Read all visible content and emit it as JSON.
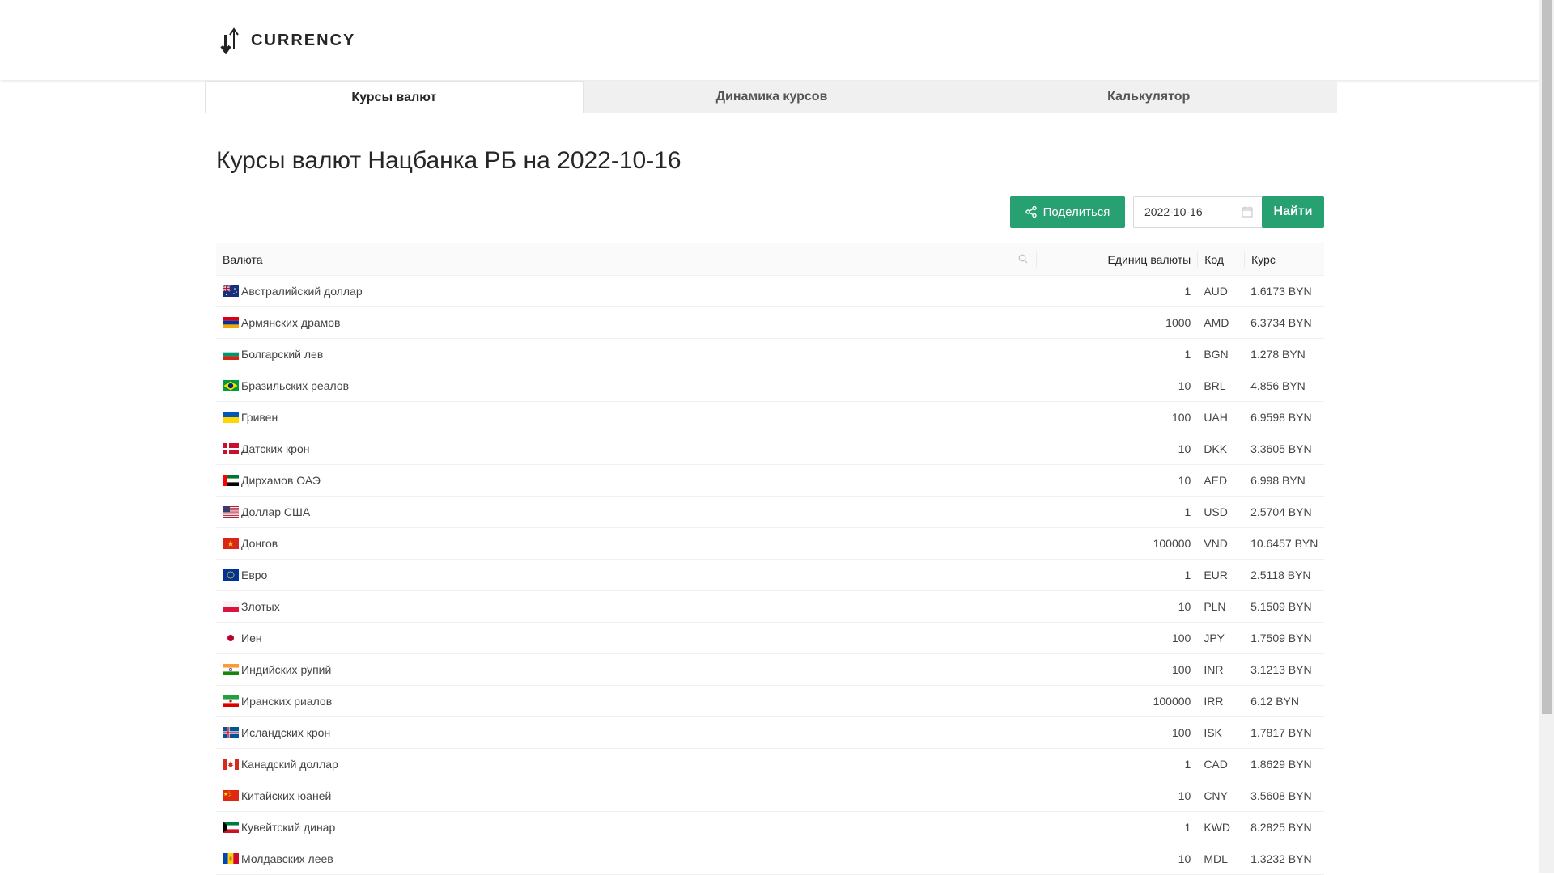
{
  "app": {
    "logo_text": "CURRENCY"
  },
  "tabs": [
    {
      "label": "Курсы валют",
      "active": true
    },
    {
      "label": "Динамика курсов",
      "active": false
    },
    {
      "label": "Калькулятор",
      "active": false
    }
  ],
  "page": {
    "title": "Курсы валют Нацбанка РБ на 2022-10-16"
  },
  "toolbar": {
    "share_label": "Поделиться",
    "date_value": "2022-10-16",
    "find_label": "Найти"
  },
  "colors": {
    "accent": "#27a172"
  },
  "table": {
    "columns": {
      "name": "Валюта",
      "units": "Единиц валюты",
      "code": "Код",
      "rate": "Курс"
    },
    "rows": [
      {
        "name": "Австралийский доллар",
        "units": "1",
        "code": "AUD",
        "rate": "1.6173 BYN",
        "flag": "au"
      },
      {
        "name": "Армянских драмов",
        "units": "1000",
        "code": "AMD",
        "rate": "6.3734 BYN",
        "flag": "am"
      },
      {
        "name": "Болгарский лев",
        "units": "1",
        "code": "BGN",
        "rate": "1.278 BYN",
        "flag": "bg"
      },
      {
        "name": "Бразильских реалов",
        "units": "10",
        "code": "BRL",
        "rate": "4.856 BYN",
        "flag": "br"
      },
      {
        "name": "Гривен",
        "units": "100",
        "code": "UAH",
        "rate": "6.9598 BYN",
        "flag": "ua"
      },
      {
        "name": "Датских крон",
        "units": "10",
        "code": "DKK",
        "rate": "3.3605 BYN",
        "flag": "dk"
      },
      {
        "name": "Дирхамов ОАЭ",
        "units": "10",
        "code": "AED",
        "rate": "6.998 BYN",
        "flag": "ae"
      },
      {
        "name": "Доллар США",
        "units": "1",
        "code": "USD",
        "rate": "2.5704 BYN",
        "flag": "us"
      },
      {
        "name": "Донгов",
        "units": "100000",
        "code": "VND",
        "rate": "10.6457 BYN",
        "flag": "vn"
      },
      {
        "name": "Евро",
        "units": "1",
        "code": "EUR",
        "rate": "2.5118 BYN",
        "flag": "eu"
      },
      {
        "name": "Злотых",
        "units": "10",
        "code": "PLN",
        "rate": "5.1509 BYN",
        "flag": "pl"
      },
      {
        "name": "Иен",
        "units": "100",
        "code": "JPY",
        "rate": "1.7509 BYN",
        "flag": "jp"
      },
      {
        "name": "Индийских рупий",
        "units": "100",
        "code": "INR",
        "rate": "3.1213 BYN",
        "flag": "in"
      },
      {
        "name": "Иранских риалов",
        "units": "100000",
        "code": "IRR",
        "rate": "6.12 BYN",
        "flag": "ir"
      },
      {
        "name": "Исландских крон",
        "units": "100",
        "code": "ISK",
        "rate": "1.7817 BYN",
        "flag": "is"
      },
      {
        "name": "Канадский доллар",
        "units": "1",
        "code": "CAD",
        "rate": "1.8629 BYN",
        "flag": "ca"
      },
      {
        "name": "Китайских юаней",
        "units": "10",
        "code": "CNY",
        "rate": "3.5608 BYN",
        "flag": "cn"
      },
      {
        "name": "Кувейтский динар",
        "units": "1",
        "code": "KWD",
        "rate": "8.2825 BYN",
        "flag": "kw"
      },
      {
        "name": "Молдавских леев",
        "units": "10",
        "code": "MDL",
        "rate": "1.3232 BYN",
        "flag": "md"
      }
    ]
  }
}
